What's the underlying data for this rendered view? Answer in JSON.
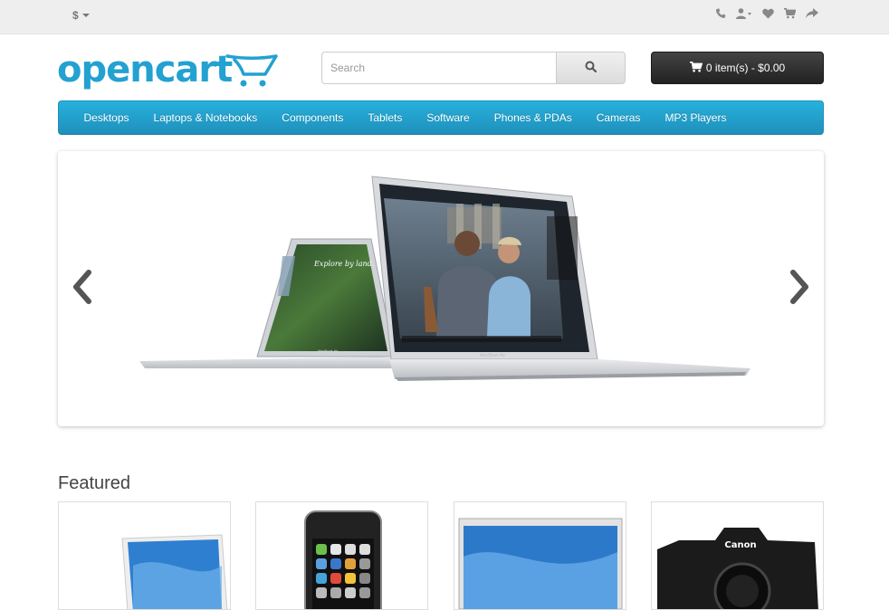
{
  "topbar": {
    "currency_label": "$",
    "icons": [
      "phone-icon",
      "user-icon",
      "heart-icon",
      "cart-icon",
      "share-icon"
    ]
  },
  "header": {
    "logo_text": "opencart",
    "search_placeholder": "Search",
    "cart_label": "0 item(s) - $0.00"
  },
  "menu": {
    "items": [
      "Desktops",
      "Laptops & Notebooks",
      "Components",
      "Tablets",
      "Software",
      "Phones & PDAs",
      "Cameras",
      "MP3 Players"
    ]
  },
  "slideshow": {
    "caption_small_laptop": "Explore by land.",
    "small_brand": "MacBook Air",
    "large_brand": "MacBook Air"
  },
  "featured": {
    "title": "Featured",
    "camera_brand": "Canon"
  },
  "colors": {
    "accent": "#229ac8",
    "logo": "#23a1d1",
    "topbar": "#eeeeee",
    "cart_button": "#303030"
  }
}
